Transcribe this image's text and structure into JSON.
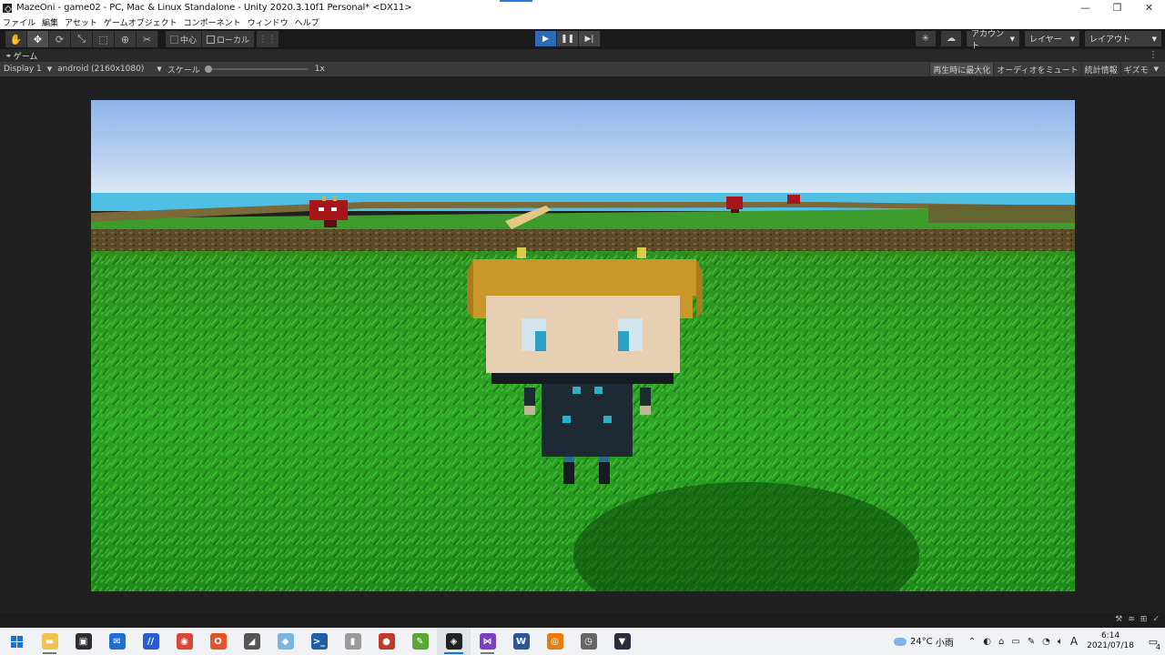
{
  "window": {
    "title": "MazeOni - game02 - PC, Mac & Linux Standalone - Unity 2020.3.10f1 Personal* <DX11>",
    "minimize": "—",
    "maximize": "❐",
    "close": "✕"
  },
  "menu": [
    "ファイル",
    "編集",
    "アセット",
    "ゲームオブジェクト",
    "コンポーネント",
    "ウィンドウ",
    "ヘルプ"
  ],
  "toolbar": {
    "tools": [
      {
        "name": "hand-tool",
        "icon": "hand-icon",
        "glyph": "✋"
      },
      {
        "name": "move-tool",
        "icon": "move-icon",
        "glyph": "✥",
        "active": true
      },
      {
        "name": "rotate-tool",
        "icon": "rotate-icon",
        "glyph": "⟳"
      },
      {
        "name": "scale-tool",
        "icon": "scale-icon",
        "glyph": "⤡"
      },
      {
        "name": "rect-tool",
        "icon": "rect-icon",
        "glyph": "⬚"
      },
      {
        "name": "transform-tool",
        "icon": "transform-icon",
        "glyph": "⊕"
      },
      {
        "name": "custom-tool",
        "icon": "wrench-icon",
        "glyph": "✂"
      }
    ],
    "pivot_label": "中心",
    "space_label": "ローカル",
    "snap_glyph": "⋮⋮",
    "play_glyph": "▶",
    "pause_glyph": "❚❚",
    "step_glyph": "▶|",
    "collab_glyph": "✳",
    "cloud_glyph": "☁",
    "account_label": "アカウント",
    "layers_label": "レイヤー",
    "layout_label": "レイアウト",
    "dropdown_arrow": "▼"
  },
  "game_tab": {
    "icon_glyph": "⚭",
    "label": "ゲーム",
    "menu_glyph": "⋮",
    "display": "Display 1",
    "resolution": "android (2160x1080)",
    "scale_label": "スケール",
    "scale_value": "1x",
    "scale_fraction": 0.0,
    "maximize_on_play": "再生時に最大化",
    "mute_audio": "オーディオをミュート",
    "stats": "統計情報",
    "gizmos": "ギズモ",
    "caret": "▼"
  },
  "statusbar": {
    "icons": [
      "⚒",
      "≋",
      "⊞",
      "✓"
    ]
  },
  "taskbar": {
    "apps": [
      {
        "name": "file-explorer",
        "icon": "folder-icon",
        "color": "#f2c14e",
        "glyph": "▬",
        "running": true
      },
      {
        "name": "store",
        "icon": "store-icon",
        "color": "#2d2d2d",
        "glyph": "▣",
        "running": false
      },
      {
        "name": "mail",
        "icon": "mail-icon",
        "color": "#1f6fd1",
        "glyph": "✉",
        "running": false
      },
      {
        "name": "visual-studio-app",
        "icon": "vs-icon",
        "color": "#2a5bd7",
        "glyph": "∕∕",
        "running": false
      },
      {
        "name": "chrome",
        "icon": "chrome-icon",
        "color": "#db4437",
        "glyph": "◉",
        "running": false
      },
      {
        "name": "office",
        "icon": "office-icon",
        "color": "#e8522a",
        "glyph": "O",
        "running": false
      },
      {
        "name": "app-fox",
        "icon": "fox-icon",
        "color": "#555555",
        "glyph": "◢",
        "running": false
      },
      {
        "name": "app-cube",
        "icon": "cube-icon",
        "color": "#7cb6e0",
        "glyph": "◆",
        "running": false
      },
      {
        "name": "powershell",
        "icon": "powershell-icon",
        "color": "#1e5fa8",
        "glyph": ">_",
        "running": false
      },
      {
        "name": "app-mic",
        "icon": "mic-icon",
        "color": "#9a9a9a",
        "glyph": "▮",
        "running": false
      },
      {
        "name": "app-record",
        "icon": "record-icon",
        "color": "#c0392b",
        "glyph": "●",
        "running": false
      },
      {
        "name": "app-leaf",
        "icon": "leaf-icon",
        "color": "#5aa832",
        "glyph": "✎",
        "running": false
      },
      {
        "name": "unity",
        "icon": "unity-icon",
        "color": "#222222",
        "glyph": "◈",
        "running": true,
        "active": true
      },
      {
        "name": "visual-studio",
        "icon": "vs-purple-icon",
        "color": "#7b3fc4",
        "glyph": "⋈",
        "running": true
      },
      {
        "name": "word",
        "icon": "word-icon",
        "color": "#2b5797",
        "glyph": "W",
        "running": false
      },
      {
        "name": "blender",
        "icon": "blender-icon",
        "color": "#e87d0d",
        "glyph": "◎",
        "running": false
      },
      {
        "name": "app-clock",
        "icon": "clock-icon",
        "color": "#666666",
        "glyph": "◷",
        "running": false
      },
      {
        "name": "app-cat",
        "icon": "cat-icon",
        "color": "#2b2b3b",
        "glyph": "▼",
        "running": false
      }
    ],
    "weather_temp": "24°C",
    "weather_text": "小雨",
    "tray_icons": [
      "⌃",
      "◐",
      "⌂",
      "▭",
      "✎",
      "◔",
      "🔈︎"
    ],
    "ime": "A",
    "time": "6:14",
    "date": "2021/07/18",
    "notifications": "4"
  }
}
